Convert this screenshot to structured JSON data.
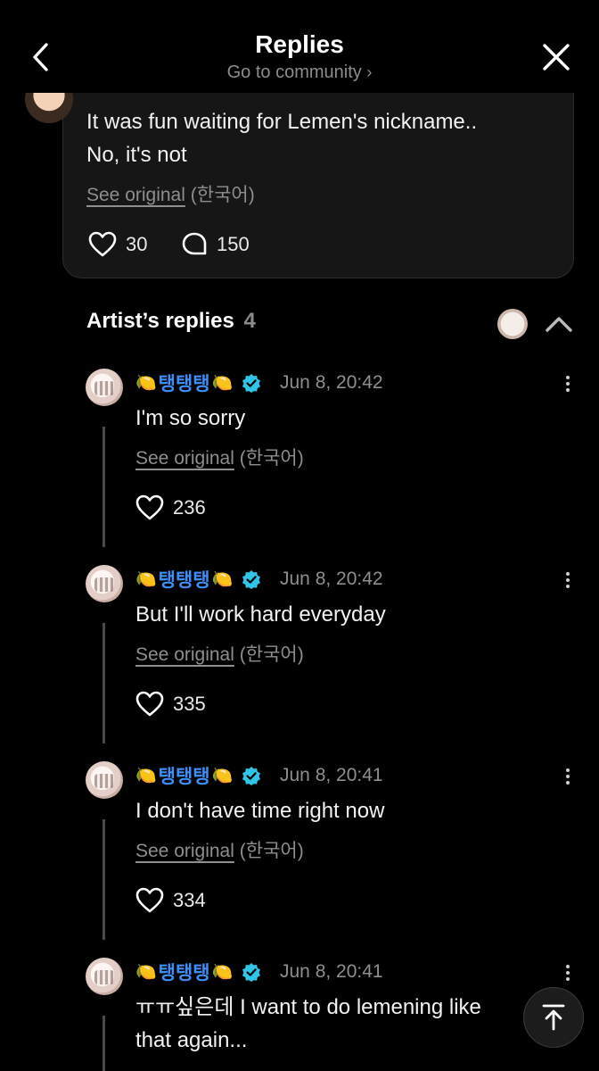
{
  "header": {
    "title": "Replies",
    "subtitle": "Go to community",
    "subtitle_chevron": "›"
  },
  "post": {
    "text_line1": "It was fun waiting for Lemen's nickname..",
    "text_line2": "No, it's not",
    "see_original": "See original",
    "language": "(한국어)",
    "likes": "30",
    "comments": "150"
  },
  "artist_replies": {
    "label": "Artist’s replies",
    "count": "4"
  },
  "replies": [
    {
      "name": "탱탱탱",
      "time": "Jun 8, 20:42",
      "text": "I'm so sorry",
      "see_original": "See original",
      "language": "(한국어)",
      "likes": "236"
    },
    {
      "name": "탱탱탱",
      "time": "Jun 8, 20:42",
      "text": "But I'll work hard everyday",
      "see_original": "See original",
      "language": "(한국어)",
      "likes": "335"
    },
    {
      "name": "탱탱탱",
      "time": "Jun 8, 20:41",
      "text": "I don't have time right now",
      "see_original": "See original",
      "language": "(한국어)",
      "likes": "334"
    },
    {
      "name": "탱탱탱",
      "time": "Jun 8, 20:41",
      "text_line1": "ㅠㅠ싶은데 I want to do lemening like",
      "text_line2": "that again..."
    }
  ],
  "name_emoji": "🍋",
  "icons": [
    "back-chevron-icon",
    "close-icon",
    "heart-icon",
    "comment-bubble-icon",
    "chevron-up-icon",
    "verified-badge-icon",
    "more-vertical-icon",
    "scroll-to-top-icon"
  ],
  "colors": {
    "background": "#000000",
    "card": "#161616",
    "artist_name": "#3b8ff6",
    "verified": "#2fc4e8",
    "muted": "#8e8e8e"
  }
}
